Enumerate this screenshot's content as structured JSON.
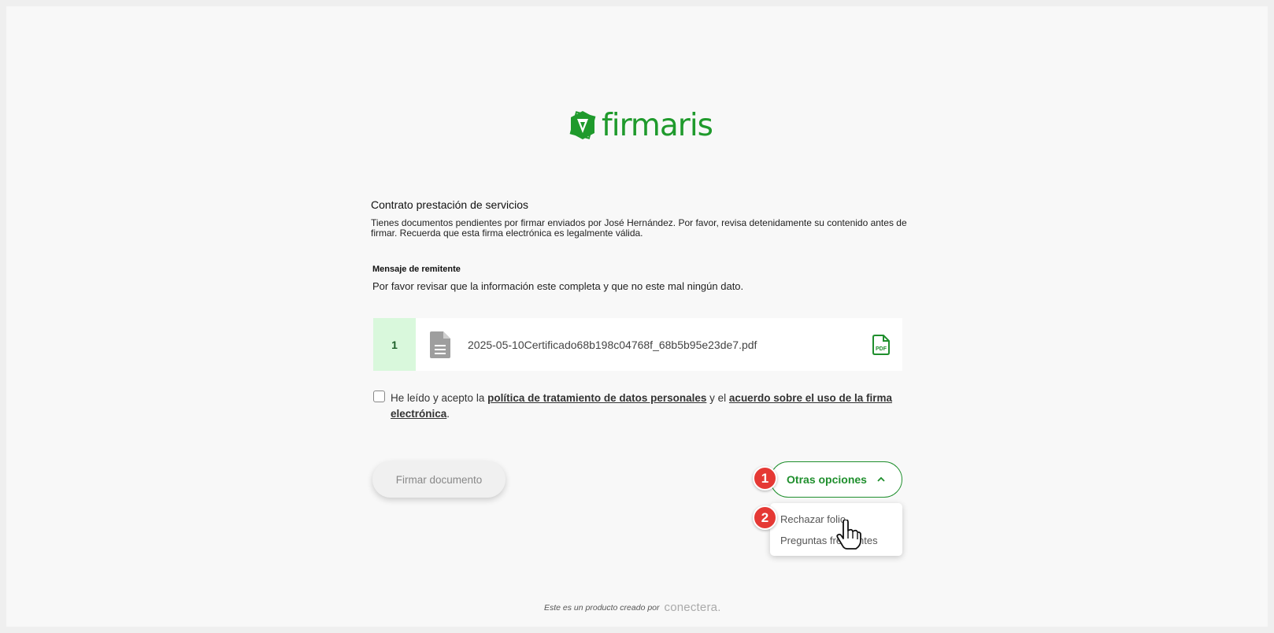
{
  "brand": {
    "logo_text": "firmaris",
    "accent_color": "#1f9a2c"
  },
  "document": {
    "title": "Contrato prestación de servicios",
    "intro": "Tienes documentos pendientes por firmar enviados por José Hernández. Por favor, revisa detenidamente su contenido antes de firmar. Recuerda que esta firma electrónica es legalmente válida."
  },
  "sender_message": {
    "label": "Mensaje de remitente",
    "text": "Por favor revisar que la información este completa y que no este mal ningún dato."
  },
  "files": [
    {
      "index": "1",
      "name": "2025-05-10Certificado68b198c04768f_68b5b95e23de7.pdf",
      "icon": "file-document-icon",
      "action_icon": "pdf-icon"
    }
  ],
  "consent": {
    "prefix": "He leído y acepto la ",
    "link1": "política de tratamiento de datos personales",
    "middle": " y el ",
    "link2": "acuerdo sobre el uso de la firma electrónica",
    "suffix": ".",
    "checked": false
  },
  "actions": {
    "sign_label": "Firmar documento",
    "other_label": "Otras opciones",
    "menu_items": [
      "Rechazar folio",
      "Preguntas frecuentes"
    ]
  },
  "annotations": {
    "badge1": "1",
    "badge2": "2"
  },
  "footer": {
    "text": "Este es un producto creado por",
    "brand": "conectera."
  }
}
